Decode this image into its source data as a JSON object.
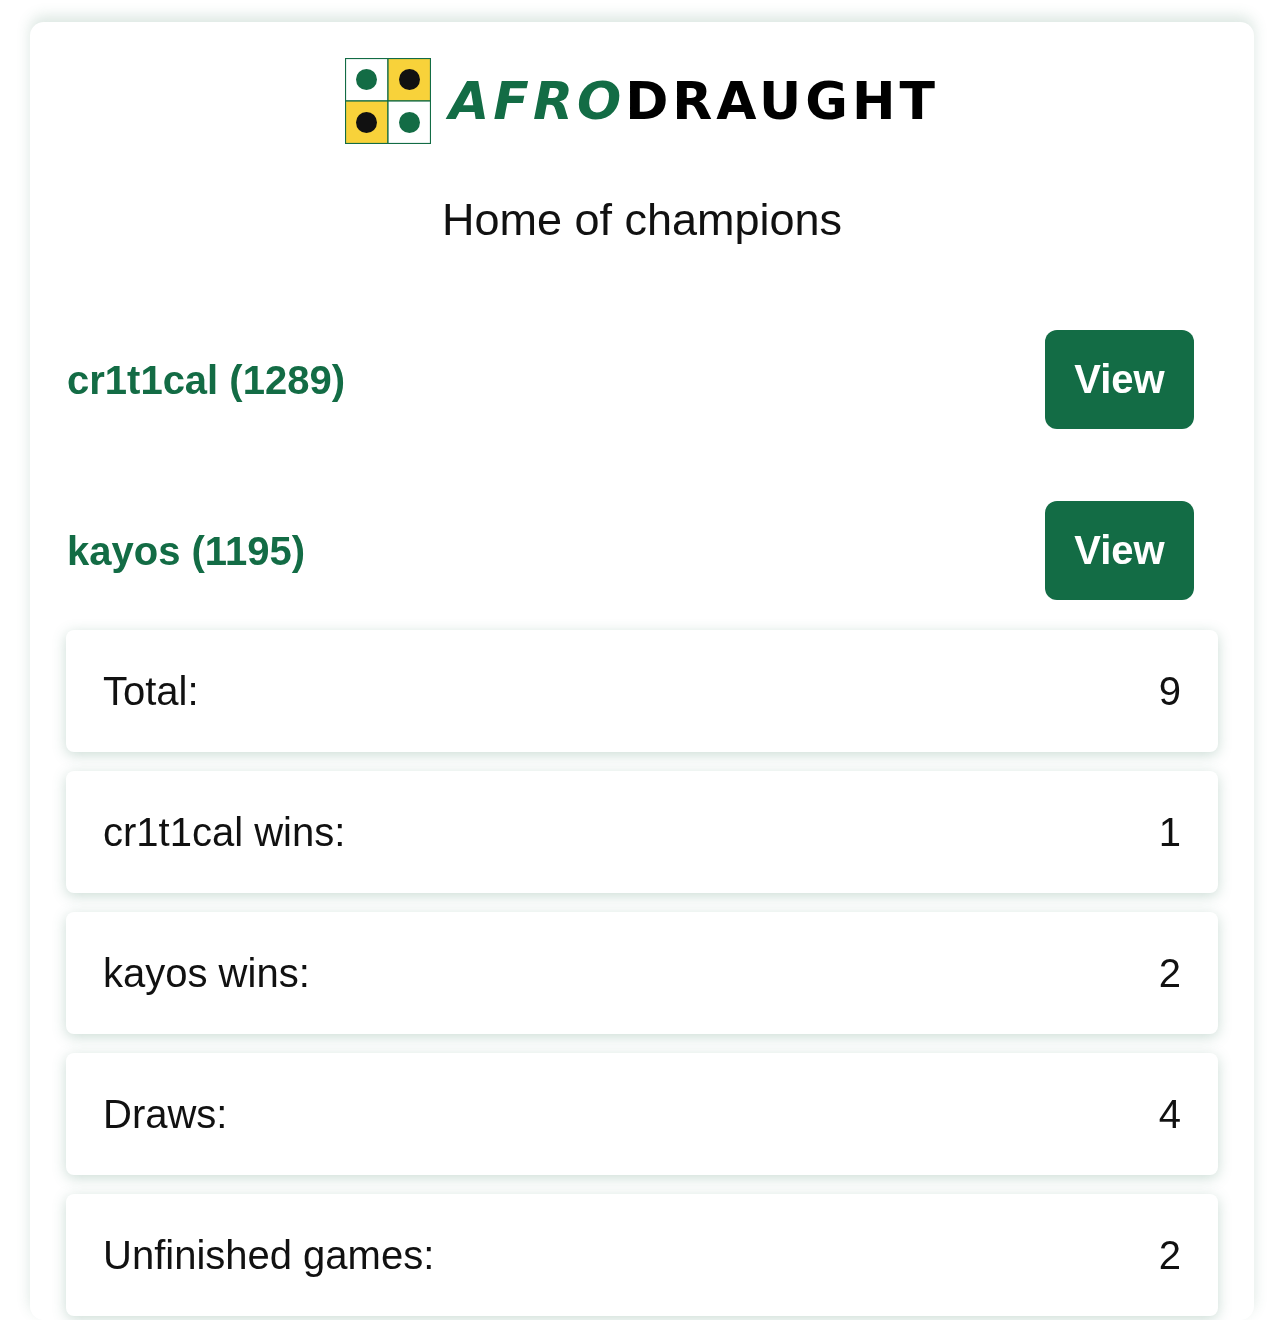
{
  "header": {
    "wordmark": {
      "first_part": "AFRO",
      "second_part": "DRAUGHT"
    },
    "tagline": "Home of champions"
  },
  "players": [
    {
      "name": "cr1t1cal (1289)",
      "action": "View"
    },
    {
      "name": "kayos (1195)",
      "action": "View"
    }
  ],
  "stats": [
    {
      "label": "Total:",
      "value": "9"
    },
    {
      "label": "cr1t1cal wins:",
      "value": "1"
    },
    {
      "label": "kayos wins:",
      "value": "2"
    },
    {
      "label": "Draws:",
      "value": "4"
    },
    {
      "label": "Unfinished games:",
      "value": "2"
    }
  ]
}
